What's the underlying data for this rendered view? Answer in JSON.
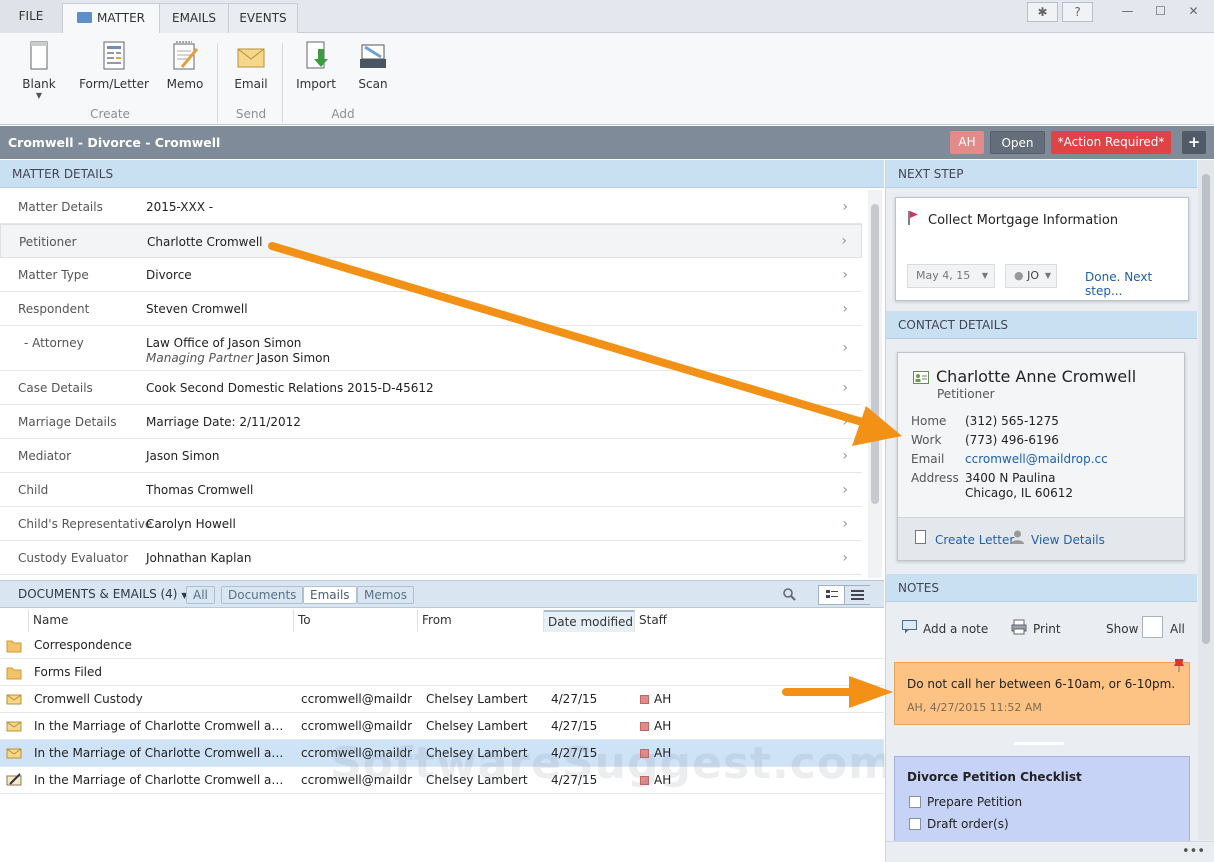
{
  "tabs": {
    "file": "FILE",
    "matter": "MATTER",
    "emails": "EMAILS",
    "events": "EVENTS"
  },
  "window_buttons": {
    "settings": "✱",
    "help": "?",
    "minimize": "—",
    "maximize": "☐",
    "close": "✕"
  },
  "ribbon": {
    "blank": "Blank",
    "form_letter": "Form/Letter",
    "memo": "Memo",
    "email": "Email",
    "import": "Import",
    "scan": "Scan",
    "group_create": "Create",
    "group_send": "Send",
    "group_add": "Add"
  },
  "matter": {
    "title": "Cromwell - Divorce - Cromwell",
    "badge": "AH",
    "status": "Open",
    "action": "*Action Required*",
    "add": "+"
  },
  "matter_details": {
    "header": "MATTER DETAILS",
    "rows": [
      {
        "label": "Matter Details",
        "value": "2015-XXX -"
      },
      {
        "label": "Petitioner",
        "value": "Charlotte Cromwell"
      },
      {
        "label": "Matter Type",
        "value": "Divorce"
      },
      {
        "label": "Respondent",
        "value": "Steven Cromwell"
      },
      {
        "label": "-  Attorney",
        "value": "Law Office of Jason Simon",
        "sub_role": "Managing Partner",
        "sub_name": " Jason Simon"
      },
      {
        "label": "Case Details",
        "value": "Cook Second Domestic Relations 2015-D-45612"
      },
      {
        "label": "Marriage Details",
        "value": "Marriage Date: 2/11/2012"
      },
      {
        "label": "Mediator",
        "value": "Jason Simon"
      },
      {
        "label": "Child",
        "value": "Thomas Cromwell"
      },
      {
        "label": "Child's Representative",
        "value": "Carolyn Howell"
      },
      {
        "label": "Custody Evaluator",
        "value": "Johnathan Kaplan"
      }
    ]
  },
  "documents": {
    "header": "DOCUMENTS & EMAILS (4)",
    "filters": {
      "all": "All",
      "documents": "Documents",
      "emails": "Emails",
      "memos": "Memos"
    },
    "columns": {
      "name": "Name",
      "to": "To",
      "from": "From",
      "date": "Date modified",
      "staff": "Staff"
    },
    "folders": [
      "Correspondence",
      "Forms Filed"
    ],
    "rows": [
      {
        "name": "Cromwell Custody",
        "to": "ccromwell@maildrop.cc",
        "from": "Chelsey Lambert",
        "date": "4/27/15",
        "staff": "AH"
      },
      {
        "name": "In the Marriage of Charlotte Cromwell and Steven Cromwell",
        "to": "ccromwell@maildrop.cc",
        "from": "Chelsey Lambert",
        "date": "4/27/15",
        "staff": "AH"
      },
      {
        "name": "In the Marriage of Charlotte Cromwell and Steven Cromwell",
        "to": "ccromwell@maildrop.cc",
        "from": "Chelsey Lambert",
        "date": "4/27/15",
        "staff": "AH"
      },
      {
        "name": "In the Marriage of Charlotte Cromwell and Steven Cromwell",
        "to": "ccromwell@maildrop.cc",
        "from": "Chelsey Lambert",
        "date": "4/27/15",
        "staff": "AH"
      }
    ]
  },
  "next_step": {
    "header": "NEXT STEP",
    "task": "Collect Mortgage Information",
    "date": "May 4, 15",
    "assignee": "JO",
    "done": "Done. Next step..."
  },
  "contact": {
    "header": "CONTACT DETAILS",
    "name": "Charlotte Anne Cromwell",
    "role": "Petitioner",
    "home_label": "Home",
    "home": "(312) 565-1275",
    "work_label": "Work",
    "work": "(773) 496-6196",
    "email_label": "Email",
    "email": "ccromwell@maildrop.cc",
    "address_label": "Address",
    "address1": "3400 N Paulina",
    "address2": "Chicago, IL 60612",
    "create_letter": "Create Letter",
    "view_details": "View Details"
  },
  "notes": {
    "header": "NOTES",
    "add": "Add a note",
    "print": "Print",
    "show": "Show",
    "all": "All",
    "note_text": "Do not call her between 6-10am, or 6-10pm.",
    "note_meta": "AH, 4/27/2015 11:52 AM",
    "checklist_title": "Divorce Petition Checklist",
    "checklist": [
      "Prepare Petition",
      "Draft order(s)"
    ]
  },
  "watermark": "SoftwareSuggest.com",
  "colors": {
    "accent_orange": "#f39016",
    "action_red": "#e04343",
    "header_blue": "#c9e0f2",
    "note_orange": "#fdc384",
    "checklist_blue": "#c7d3f6"
  }
}
